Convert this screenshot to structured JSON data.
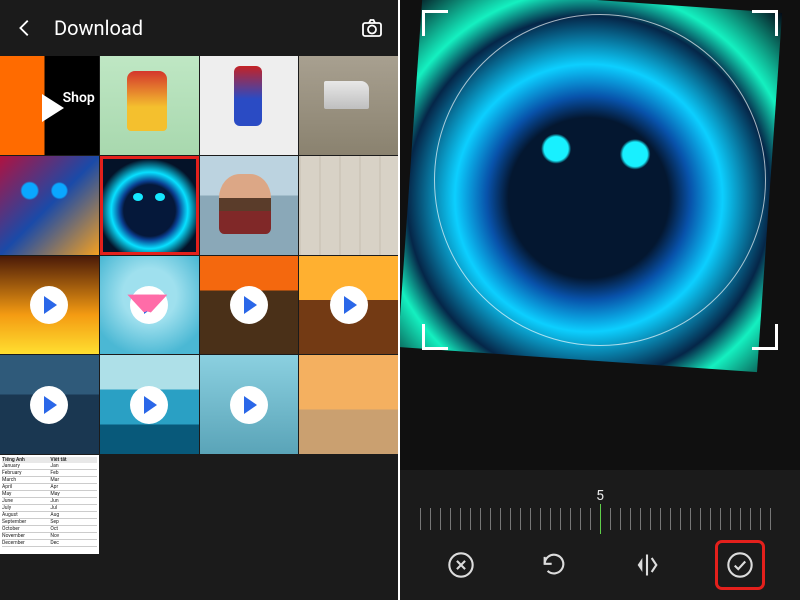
{
  "left": {
    "title": "Download",
    "thumbnails": [
      {
        "name": "fpt-shop",
        "label": "Shop",
        "type": "image"
      },
      {
        "name": "ironman-figure",
        "type": "image"
      },
      {
        "name": "spiderman-figure",
        "type": "image"
      },
      {
        "name": "cleaver-knife",
        "type": "image"
      },
      {
        "name": "neon-cat",
        "type": "image"
      },
      {
        "name": "blue-leopard",
        "type": "image",
        "selected": true
      },
      {
        "name": "messi-portrait",
        "type": "image"
      },
      {
        "name": "paper-texture",
        "type": "image"
      },
      {
        "name": "fire-hands",
        "type": "video"
      },
      {
        "name": "heart-water",
        "type": "video"
      },
      {
        "name": "mossy-tree",
        "type": "video"
      },
      {
        "name": "sunset-road",
        "type": "video"
      },
      {
        "name": "mountain-lake",
        "type": "video"
      },
      {
        "name": "ocean",
        "type": "video"
      },
      {
        "name": "waterfall",
        "type": "video"
      },
      {
        "name": "beach-sunset",
        "type": "image"
      },
      {
        "name": "spreadsheet",
        "type": "image"
      }
    ],
    "spreadsheet": {
      "headers": [
        "Tiếng Anh",
        "Viết tắt"
      ],
      "rows": [
        [
          "January",
          "Jan"
        ],
        [
          "February",
          "Feb"
        ],
        [
          "March",
          "Mar"
        ],
        [
          "April",
          "Apr"
        ],
        [
          "May",
          "May"
        ],
        [
          "June",
          "Jun"
        ],
        [
          "July",
          "Jul"
        ],
        [
          "August",
          "Aug"
        ],
        [
          "September",
          "Sep"
        ],
        [
          "October",
          "Oct"
        ],
        [
          "November",
          "Nov"
        ],
        [
          "December",
          "Dec"
        ]
      ]
    }
  },
  "right": {
    "rotation_value": "5",
    "toolbar": {
      "cancel_label": "cancel",
      "rotate_label": "rotate",
      "flip_label": "flip",
      "confirm_label": "confirm"
    }
  },
  "icons": {
    "back": "back-arrow-icon",
    "camera": "camera-icon",
    "play": "play-icon",
    "cancel": "close-circle-icon",
    "rotate": "rotate-icon",
    "flip": "flip-horizontal-icon",
    "confirm": "check-circle-icon"
  }
}
